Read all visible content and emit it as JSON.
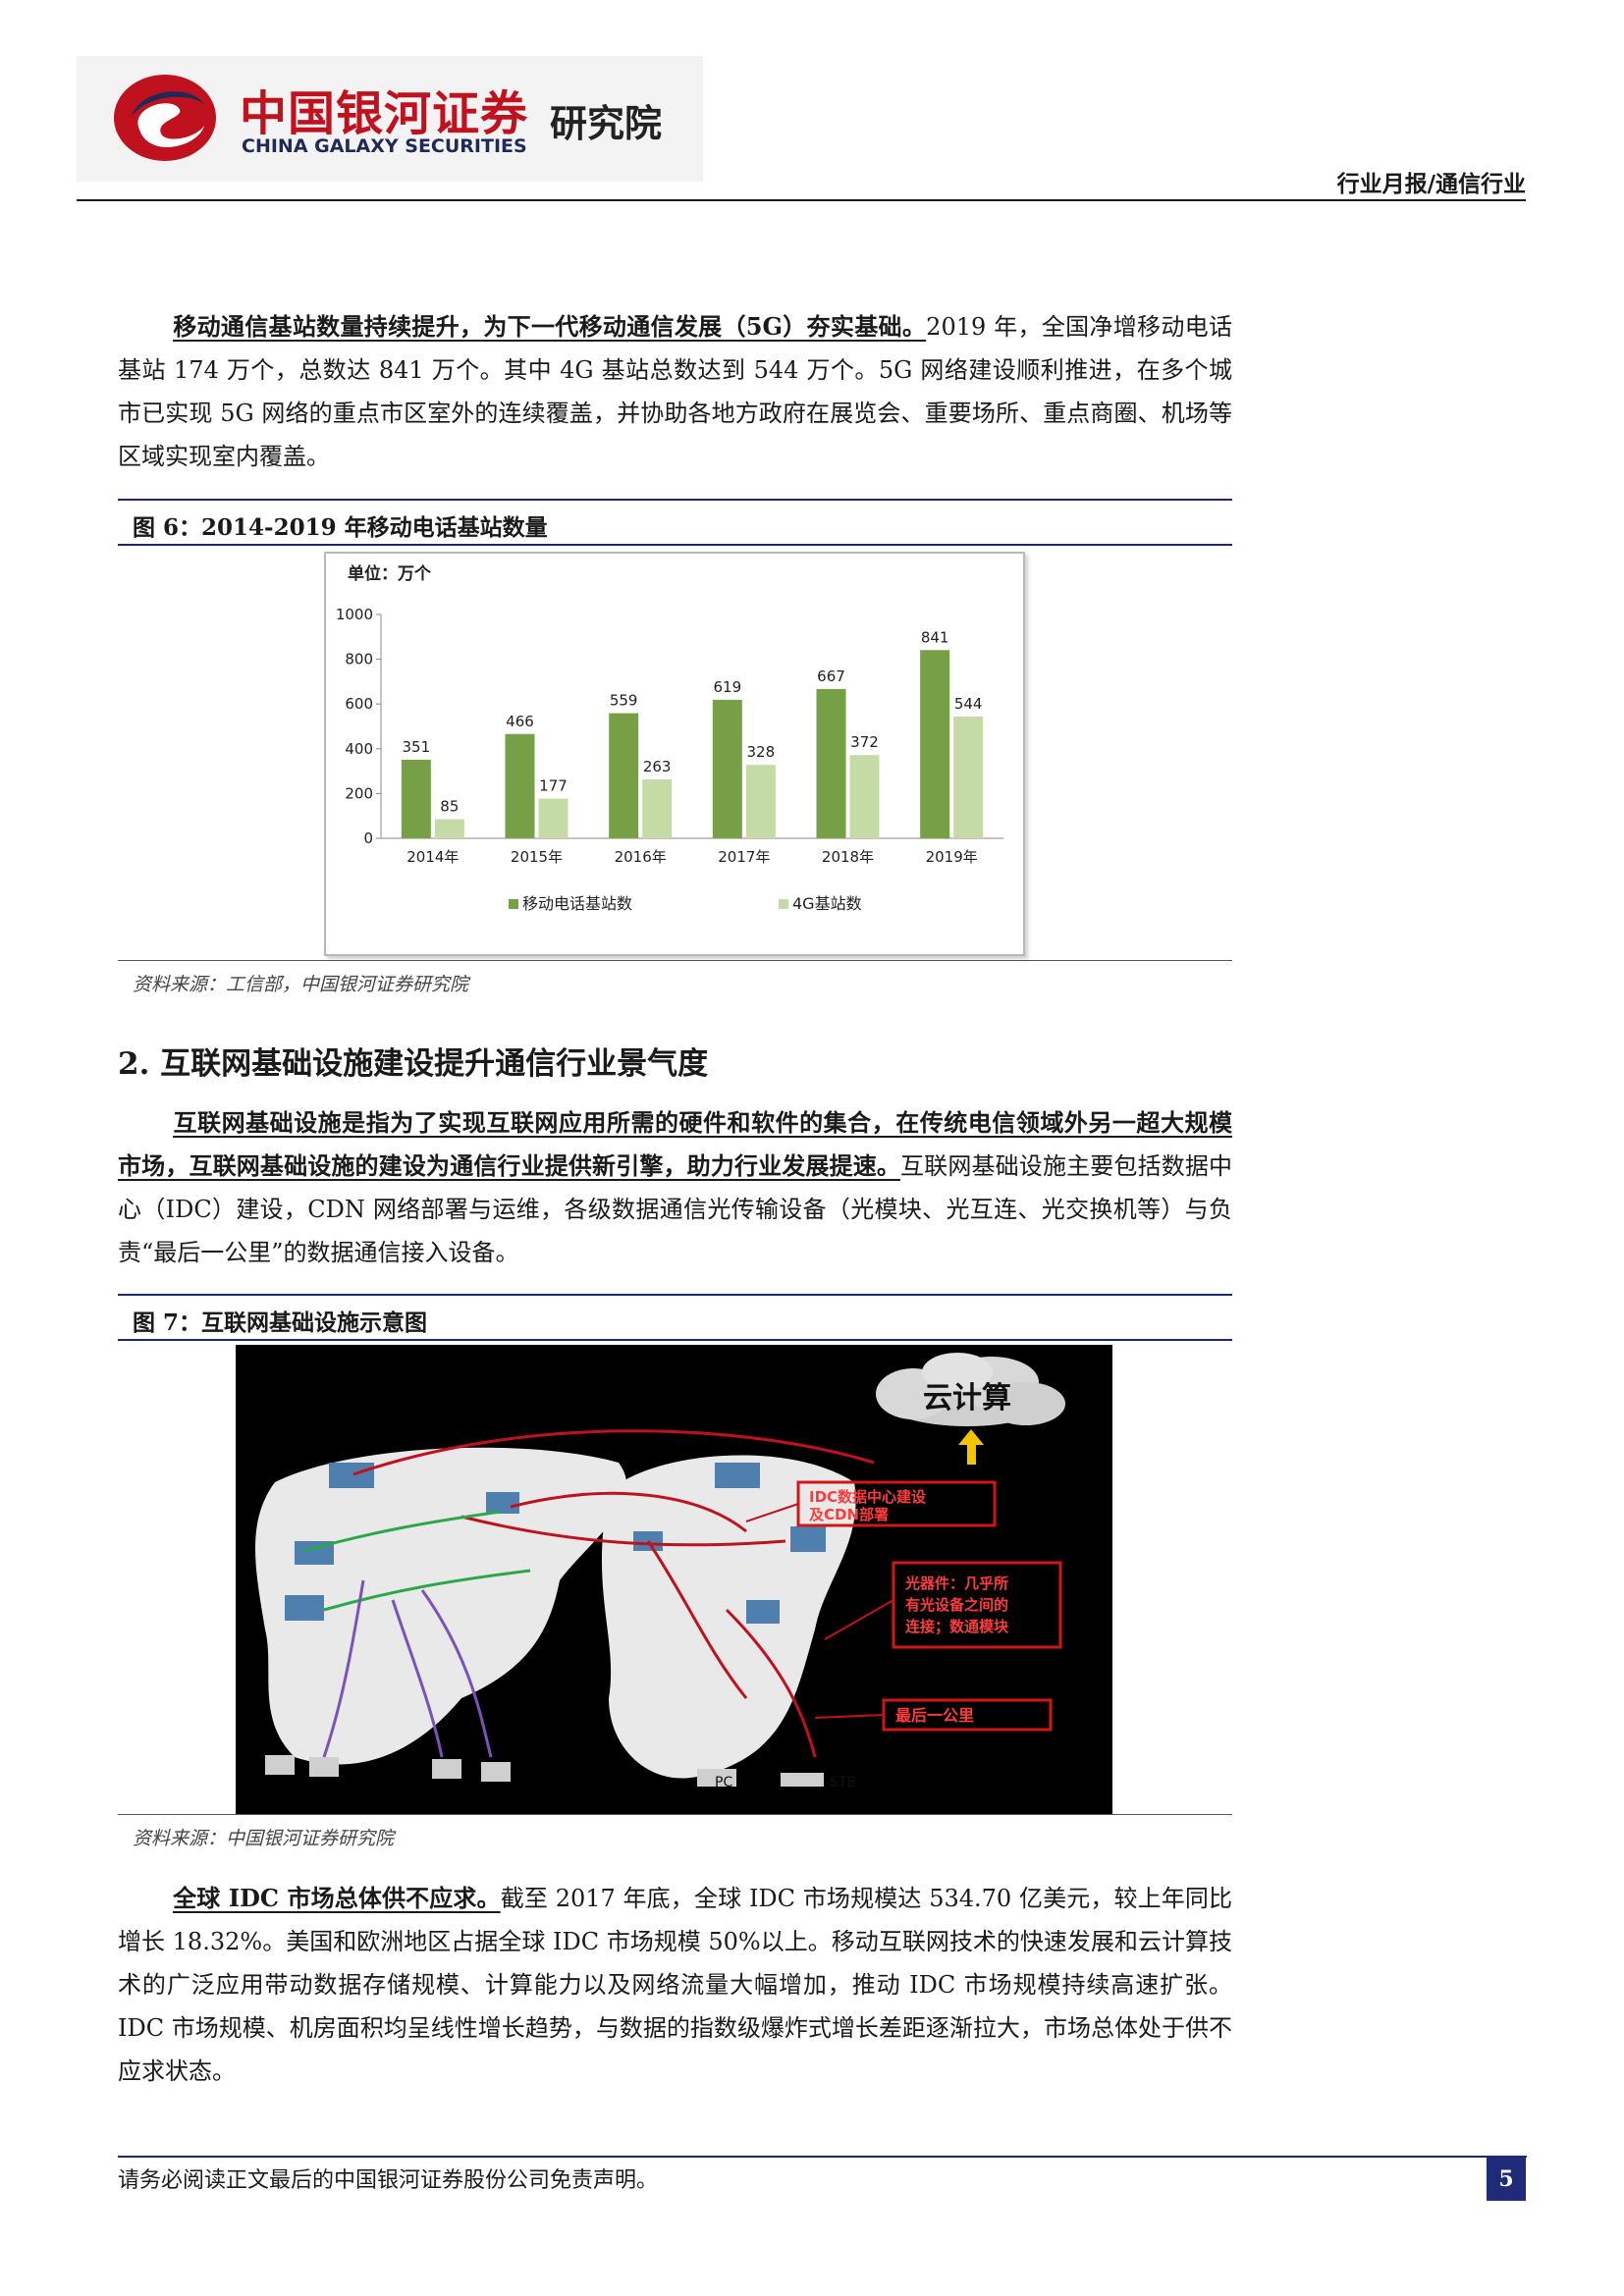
{
  "header": {
    "logo_cn": "中国银河证券",
    "logo_en": "CHINA GALAXY SECURITIES",
    "institute": "研究院",
    "category": "行业月报/通信行业"
  },
  "para1": {
    "lead": "移动通信基站数量持续提升，为下一代移动通信发展（5G）夯实基础。",
    "body": "2019 年，全国净增移动电话基站 174 万个，总数达 841 万个。其中 4G 基站总数达到 544 万个。5G 网络建设顺利推进，在多个城市已实现 5G 网络的重点市区室外的连续覆盖，并协助各地方政府在展览会、重要场所、重点商圈、机场等区域实现室内覆盖。"
  },
  "figure6": {
    "caption": "图 6：2014-2019 年移动电话基站数量",
    "source": "资料来源：工信部，中国银河证券研究院"
  },
  "chart_data": {
    "type": "bar",
    "unit_label": "单位：万个",
    "categories": [
      "2014年",
      "2015年",
      "2016年",
      "2017年",
      "2018年",
      "2019年"
    ],
    "series": [
      {
        "name": "移动电话基站数",
        "values": [
          351,
          466,
          559,
          619,
          667,
          841
        ],
        "color": "#77a046"
      },
      {
        "name": "4G基站数",
        "values": [
          85,
          177,
          263,
          328,
          372,
          544
        ],
        "color": "#c5dba6"
      }
    ],
    "ylim": [
      0,
      1000
    ],
    "yticks": [
      0,
      200,
      400,
      600,
      800,
      1000
    ],
    "legend": "bottom",
    "grid": false
  },
  "section2": {
    "title": "2. 互联网基础设施建设提升通信行业景气度"
  },
  "para2": {
    "lead": "互联网基础设施是指为了实现互联网应用所需的硬件和软件的集合，在传统电信领域外另一超大规模市场，互联网基础设施的建设为通信行业提供新引擎，助力行业发展提速。",
    "body": "互联网基础设施主要包括数据中心（IDC）建设，CDN 网络部署与运维，各级数据通信光传输设备（光模块、光互连、光交换机等）与负责“最后一公里”的数据通信接入设备。"
  },
  "figure7": {
    "caption": "图 7：互联网基础设施示意图",
    "source": "资料来源：中国银河证券研究院",
    "cloud_label": "云计算",
    "box1": [
      "IDC数据中心建设",
      "及CDN部署"
    ],
    "box2": [
      "光器件：几乎所",
      "有光设备之间的",
      "连接；数通模块"
    ],
    "box3": "最后一公里",
    "node_pc": "PC",
    "node_stb": "STB"
  },
  "para3": {
    "lead": "全球 IDC 市场总体供不应求。",
    "body": "截至 2017 年底，全球 IDC 市场规模达 534.70 亿美元，较上年同比增长 18.32%。美国和欧洲地区占据全球 IDC 市场规模 50%以上。移动互联网技术的快速发展和云计算技术的广泛应用带动数据存储规模、计算能力以及网络流量大幅增加，推动 IDC 市场规模持续高速扩张。IDC 市场规模、机房面积均呈线性增长趋势，与数据的指数级爆炸式增长差距逐渐拉大，市场总体处于供不应求状态。"
  },
  "footer": {
    "disclaimer": "请务必阅读正文最后的中国银河证券股份公司免责声明。",
    "page": "5"
  }
}
